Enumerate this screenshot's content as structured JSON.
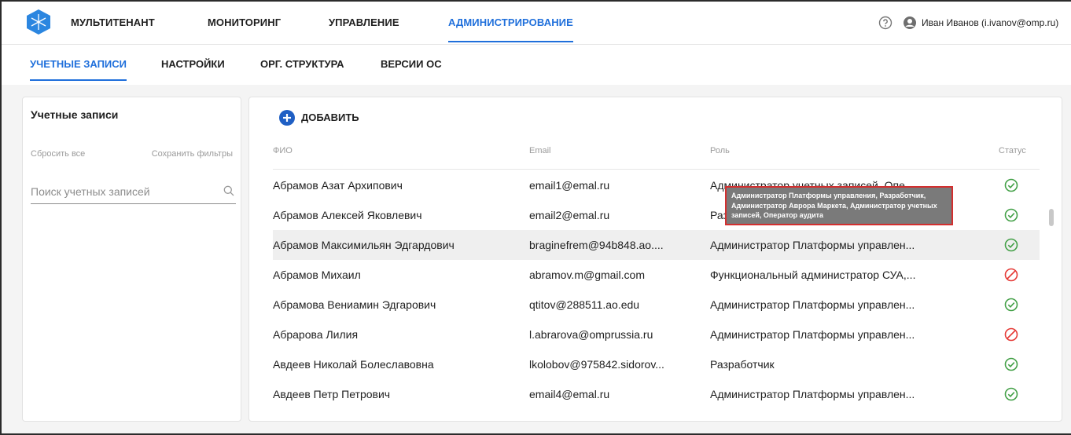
{
  "topnav": {
    "items": [
      {
        "label": "МУЛЬТИТЕНАНТ",
        "active": false
      },
      {
        "label": "МОНИТОРИНГ",
        "active": false
      },
      {
        "label": "УПРАВЛЕНИЕ",
        "active": false
      },
      {
        "label": "АДМИНИСТРИРОВАНИЕ",
        "active": true
      }
    ],
    "user": "Иван Иванов (i.ivanov@omp.ru)"
  },
  "subtabs": [
    {
      "label": "УЧЕТНЫЕ ЗАПИСИ",
      "active": true
    },
    {
      "label": "НАСТРОЙКИ",
      "active": false
    },
    {
      "label": "ОРГ. СТРУКТУРА",
      "active": false
    },
    {
      "label": "ВЕРСИИ ОС",
      "active": false
    }
  ],
  "filters": {
    "title": "Учетные записи",
    "reset": "Сбросить все",
    "save": "Сохранить фильтры",
    "search_placeholder": "Поиск учетных записей"
  },
  "table": {
    "add_label": "ДОБАВИТЬ",
    "columns": [
      "ФИО",
      "Email",
      "Роль",
      "Статус"
    ],
    "rows": [
      {
        "name": "Абрамов Азат Архипович",
        "email": "email1@emal.ru",
        "role": "Администратор учетных записей, Опе...",
        "status": "active"
      },
      {
        "name": "Абрамов Алексей Яковлевич",
        "email": "email2@emal.ru",
        "role": "Разработчик, Преподаватель Аврора М...",
        "status": "active"
      },
      {
        "name": "Абрамов Максимильян Эдгардович",
        "email": "braginefrem@94b848.ao....",
        "role": "Администратор Платформы управлен...",
        "status": "active"
      },
      {
        "name": "Абрамов Михаил",
        "email": "abramov.m@gmail.com",
        "role": "Функциональный администратор СУА,...",
        "status": "blocked"
      },
      {
        "name": "Абрамова Вениамин Эдгарович",
        "email": "qtitov@288511.ao.edu",
        "role": "Администратор Платформы управлен...",
        "status": "active"
      },
      {
        "name": "Абрарова Лилия",
        "email": "l.abrarova@omprussia.ru",
        "role": "Администратор Платформы управлен...",
        "status": "blocked"
      },
      {
        "name": "Авдеев Николай Болеславовна",
        "email": "lkolobov@975842.sidorov...",
        "role": "Разработчик",
        "status": "active"
      },
      {
        "name": "Авдеев Петр Петрович",
        "email": "email4@emal.ru",
        "role": "Администратор Платформы управлен...",
        "status": "active"
      }
    ]
  },
  "tooltip": "Администратор Платформы управления, Разработчик, Администратор Аврора Маркета, Администратор учетных записей, Оператор аудита",
  "colors": {
    "accent": "#1f6fdb",
    "ok": "#43a047",
    "blocked": "#e53935"
  }
}
